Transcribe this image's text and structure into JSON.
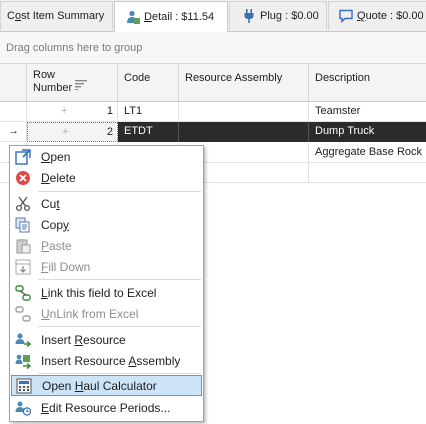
{
  "tabs": [
    {
      "id": "cost-item-summary",
      "prefix": "C",
      "u": "o",
      "rest": "st Item Summary"
    },
    {
      "id": "detail",
      "prefix": "",
      "u": "D",
      "rest": "etail : $11.54"
    },
    {
      "id": "plug",
      "prefix": "Plu",
      "u": "g",
      "rest": " : $0.00"
    },
    {
      "id": "quote",
      "prefix": "",
      "u": "Q",
      "rest": "uote : $0.00"
    }
  ],
  "group_panel": {
    "text": "Drag columns here to group"
  },
  "columns": {
    "row_number": "Row\nNumber",
    "code": "Code",
    "resource_assembly": "Resource Assembly",
    "description": "Description"
  },
  "rows": [
    {
      "row_number": "1",
      "code": "LT1",
      "resource_assembly": "",
      "description": "Teamster"
    },
    {
      "row_number": "2",
      "code": "ETDT",
      "resource_assembly": "",
      "description": "Dump Truck"
    },
    {
      "row_number": "",
      "code": "",
      "resource_assembly": "",
      "description": "Aggregate Base Rock"
    }
  ],
  "row_indicator": "→",
  "context_menu": {
    "items": [
      {
        "id": "open",
        "pre": "",
        "u": "O",
        "post": "pen",
        "icon": "open-icon",
        "disabled": false
      },
      {
        "id": "delete",
        "pre": "",
        "u": "D",
        "post": "elete",
        "icon": "delete-icon",
        "disabled": false
      },
      {
        "id": "cut",
        "pre": "Cu",
        "u": "t",
        "post": "",
        "icon": "scissors-icon",
        "disabled": false
      },
      {
        "id": "copy",
        "pre": "Cop",
        "u": "y",
        "post": "",
        "icon": "copy-icon",
        "disabled": false
      },
      {
        "id": "paste",
        "pre": "",
        "u": "P",
        "post": "aste",
        "icon": "paste-icon",
        "disabled": true
      },
      {
        "id": "fill-down",
        "pre": "",
        "u": "F",
        "post": "ill Down",
        "icon": "fill-down-icon",
        "disabled": true
      },
      {
        "id": "link-excel",
        "pre": "",
        "u": "L",
        "post": "ink this field to Excel",
        "icon": "link-icon",
        "disabled": false
      },
      {
        "id": "unlink-excel",
        "pre": "",
        "u": "U",
        "post": "nLink from Excel",
        "icon": "unlink-icon",
        "disabled": true
      },
      {
        "id": "insert-resource",
        "pre": "Insert ",
        "u": "R",
        "post": "esource",
        "icon": "insert-resource-icon",
        "disabled": false
      },
      {
        "id": "insert-resource-assembly",
        "pre": "Insert Resource ",
        "u": "A",
        "post": "ssembly",
        "icon": "insert-assembly-icon",
        "disabled": false
      },
      {
        "id": "open-haul-calculator",
        "pre": "Open ",
        "u": "H",
        "post": "aul Calculator",
        "icon": "calculator-icon",
        "disabled": false,
        "highlighted": true
      },
      {
        "id": "edit-resource-periods",
        "pre": "",
        "u": "E",
        "post": "dit Resource Periods...",
        "icon": "periods-icon",
        "disabled": false
      }
    ]
  },
  "colors": {
    "selected_row": "#2b2b2b",
    "menu_highlight": "#cce4f7",
    "menu_highlight_border": "#5b9bd5",
    "delete_red": "#e04848"
  }
}
